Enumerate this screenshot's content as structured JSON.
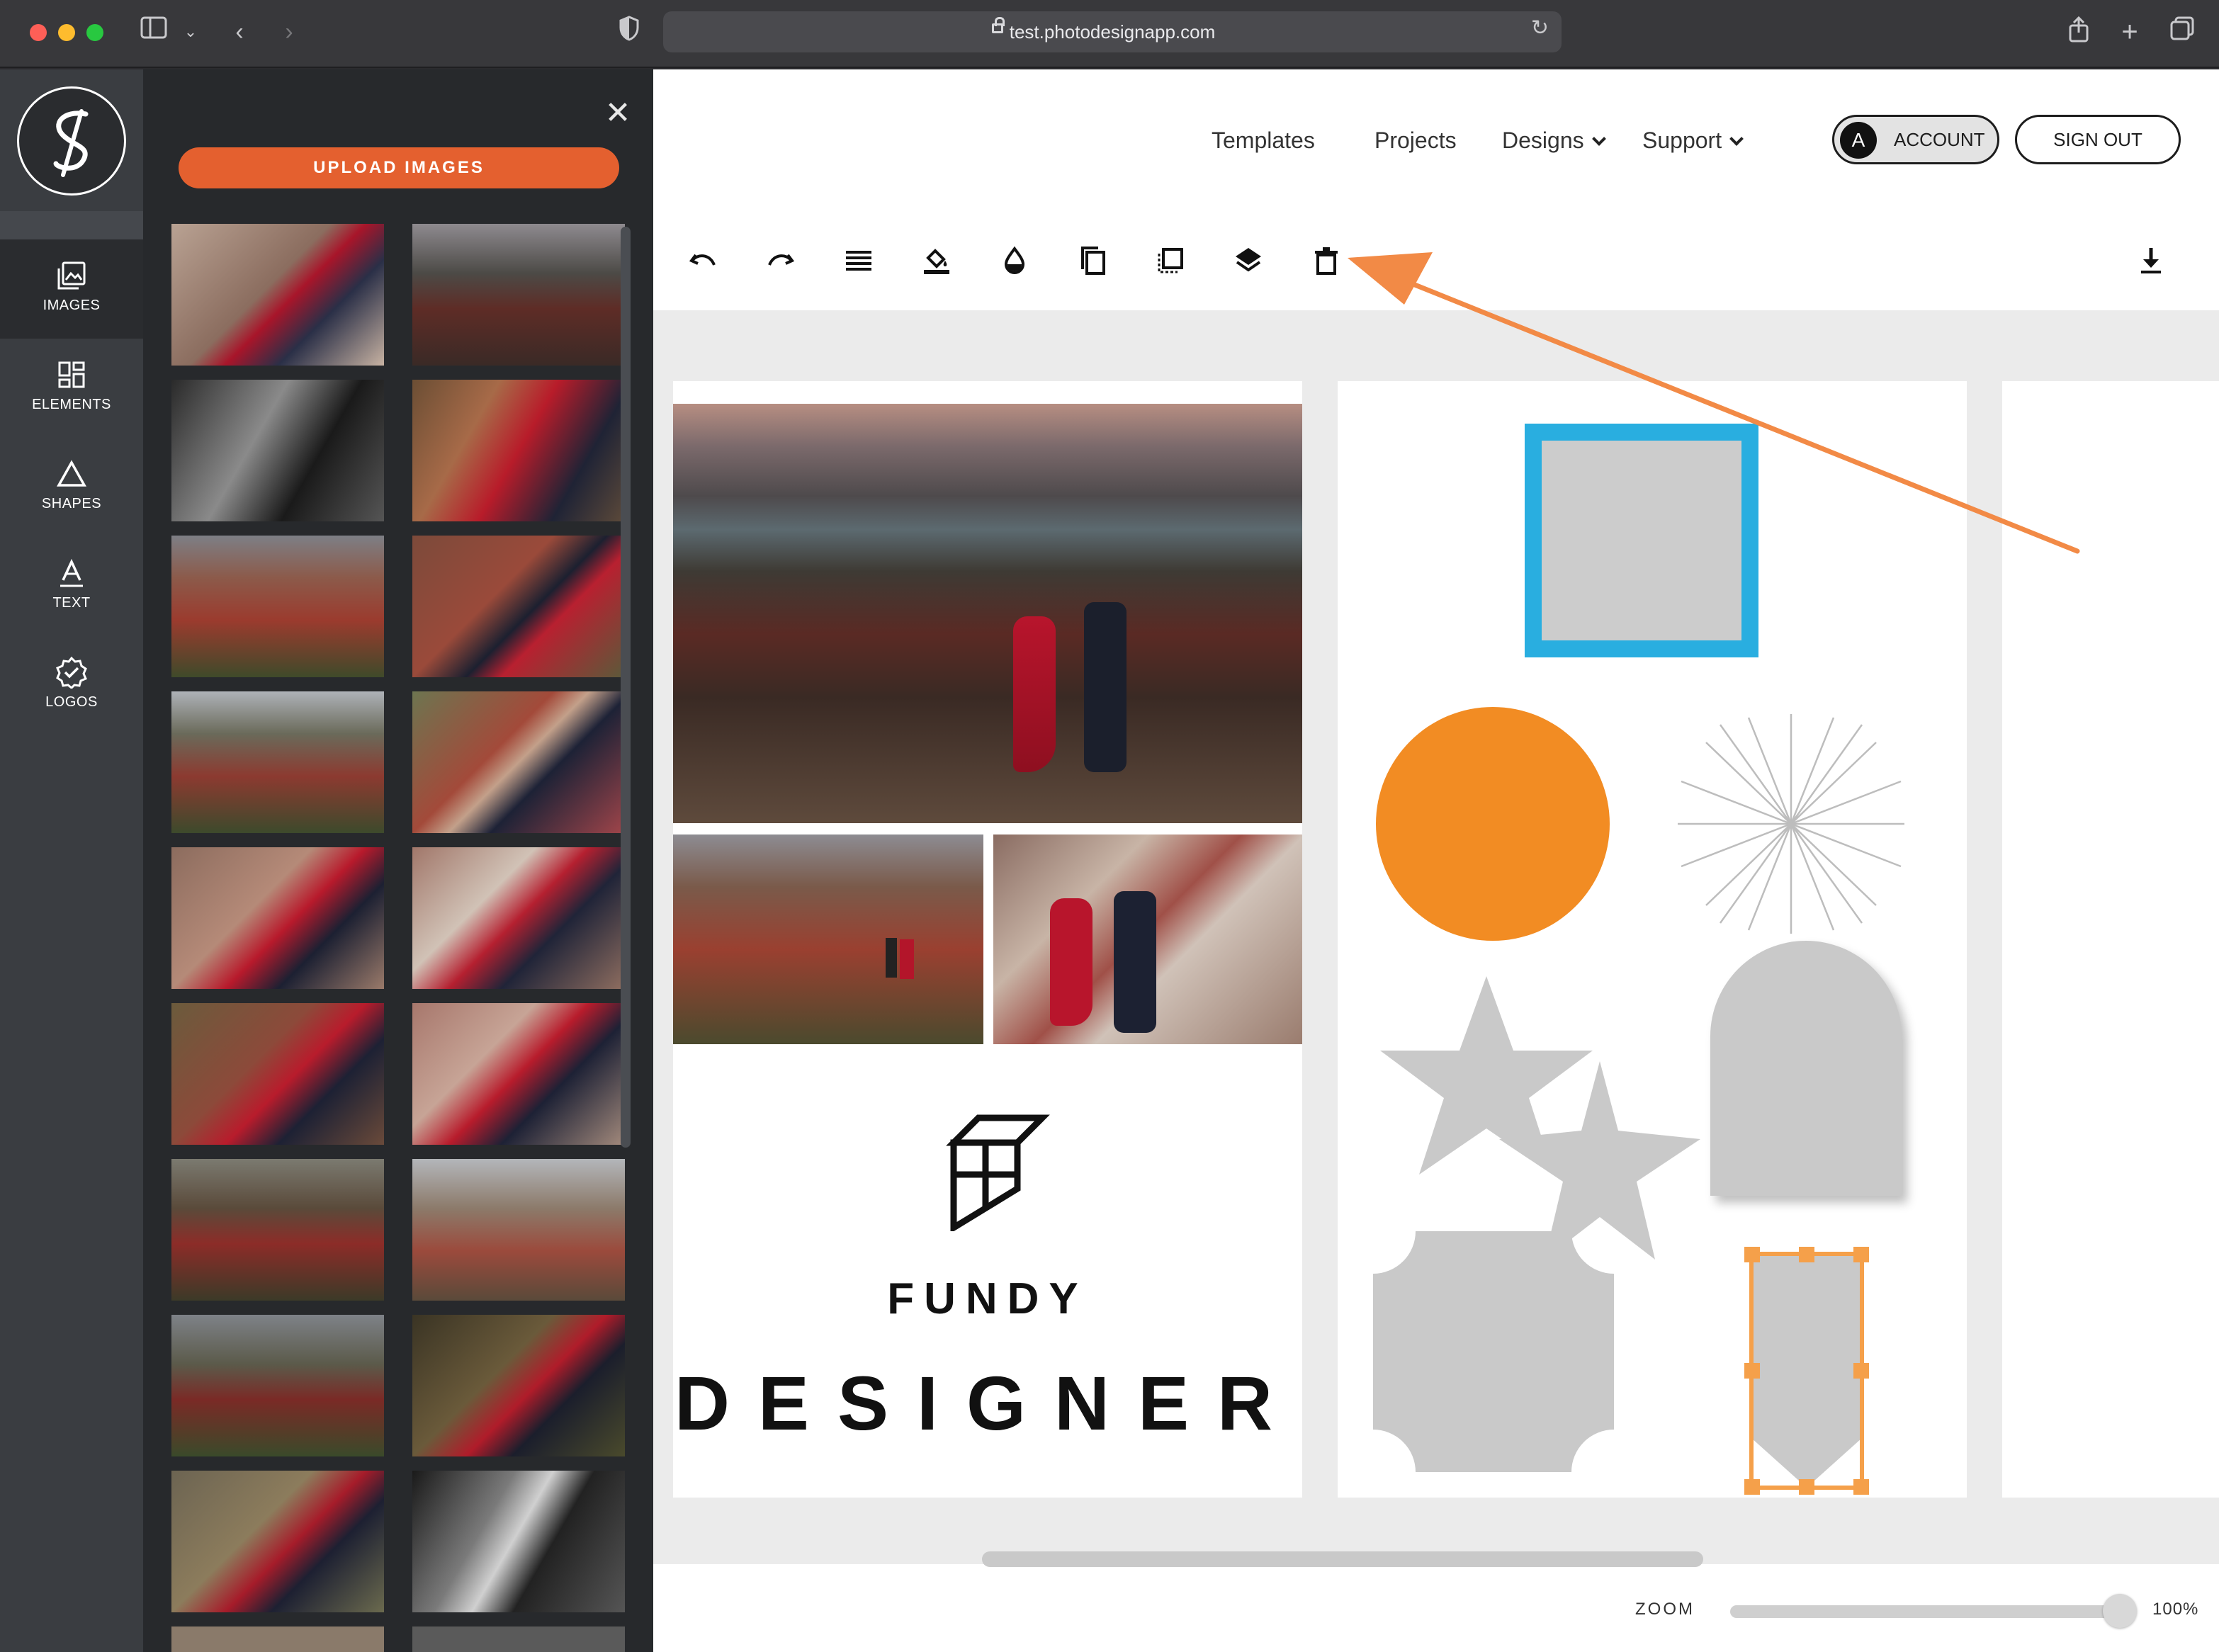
{
  "browser": {
    "url": "test.photodesignapp.com"
  },
  "rail": {
    "items": [
      {
        "label": "IMAGES",
        "icon": "images-icon"
      },
      {
        "label": "ELEMENTS",
        "icon": "elements-icon"
      },
      {
        "label": "SHAPES",
        "icon": "shapes-icon"
      },
      {
        "label": "TEXT",
        "icon": "text-icon"
      },
      {
        "label": "LOGOS",
        "icon": "logos-icon"
      }
    ]
  },
  "panel": {
    "upload_label": "UPLOAD IMAGES",
    "close_glyph": "✕"
  },
  "nav": {
    "templates": "Templates",
    "projects": "Projects",
    "designs": "Designs",
    "support": "Support",
    "account_initial": "A",
    "account": "ACCOUNT",
    "sign_out": "SIGN OUT"
  },
  "toolbar": {
    "tools": [
      "undo-icon",
      "redo-icon",
      "align-icon",
      "fill-icon",
      "opacity-icon",
      "duplicate-icon",
      "crop-icon",
      "layers-icon",
      "delete-icon"
    ],
    "download": "download-icon"
  },
  "canvas": {
    "brand_small": "FUNDY",
    "brand_big": "DESIGNER"
  },
  "colors": {
    "accent": "#e4602f",
    "shape_blue": "#29aee0",
    "shape_orange": "#f28c23",
    "selection": "#f5a04a",
    "shape_gray": "#c9c9c9",
    "annotation_arrow": "#f28a46"
  },
  "zoom": {
    "label": "ZOOM",
    "value": "100%"
  }
}
